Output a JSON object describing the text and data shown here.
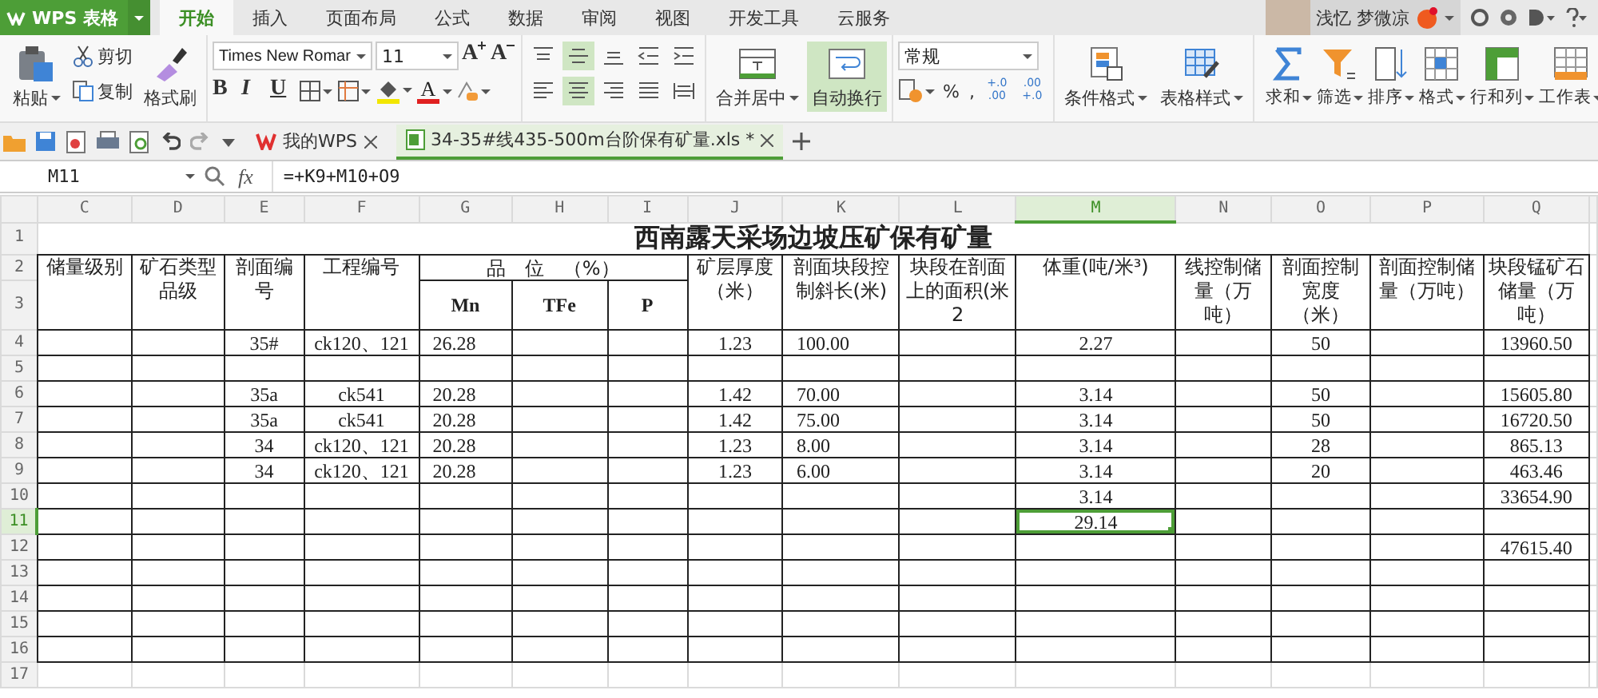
{
  "app": {
    "logo": "WPS 表格"
  },
  "menu_tabs": [
    {
      "label": "开始",
      "selected": true
    },
    {
      "label": "插入",
      "selected": false
    },
    {
      "label": "页面布局",
      "selected": false
    },
    {
      "label": "公式",
      "selected": false
    },
    {
      "label": "数据",
      "selected": false
    },
    {
      "label": "审阅",
      "selected": false
    },
    {
      "label": "视图",
      "selected": false
    },
    {
      "label": "开发工具",
      "selected": false
    },
    {
      "label": "云服务",
      "selected": false
    }
  ],
  "user": {
    "name": "浅忆 梦微凉"
  },
  "ribbon": {
    "paste": "粘贴",
    "cut": "剪切",
    "copy": "复制",
    "format_painter": "格式刷",
    "font": {
      "name": "Times New Romar",
      "size": "11"
    },
    "font_size_buttons": [
      {
        "label": "A",
        "kind": "grow"
      },
      {
        "label": "A",
        "kind": "shrink"
      }
    ],
    "style_buttons": [
      "B",
      "I",
      "U"
    ],
    "font_color": "A",
    "align_buttons": [
      {
        "kind": "top",
        "selected": false
      },
      {
        "kind": "middle",
        "selected": true
      },
      {
        "kind": "bottom",
        "selected": false
      },
      {
        "kind": "outdent",
        "selected": false
      },
      {
        "kind": "indent",
        "selected": false
      },
      {
        "kind": "left",
        "selected": false
      },
      {
        "kind": "center",
        "selected": true
      },
      {
        "kind": "right",
        "selected": false
      },
      {
        "kind": "justify",
        "selected": false
      },
      {
        "kind": "distributed",
        "selected": false
      }
    ],
    "merge": {
      "label": "合并居中"
    },
    "wrap": {
      "label": "自动换行",
      "on": true
    },
    "number_format": "常规",
    "percent": "%",
    "comma": ",",
    "decimal_buttons": [
      {
        "top": "+.0",
        "bottom": ".00"
      },
      {
        "top": ".00",
        "bottom": "+.0"
      }
    ],
    "format_buttons": [
      "条件格式",
      "表格样式"
    ],
    "tools": [
      {
        "label": "求和",
        "kind": "sum"
      },
      {
        "label": "筛选",
        "kind": "filter"
      },
      {
        "label": "排序",
        "kind": "sort"
      },
      {
        "label": "格式",
        "kind": "format"
      },
      {
        "label": "行和列",
        "kind": "rows"
      },
      {
        "label": "工作表",
        "kind": "sheet"
      }
    ]
  },
  "doc_tabs": [
    {
      "label": "我的WPS",
      "kind": "home",
      "selected": false
    },
    {
      "label": "34-35#线435-500m台阶保有矿量.xls *",
      "kind": "sheet",
      "selected": true
    }
  ],
  "formula_bar": {
    "cell": "M11",
    "fx": "fx",
    "formula": "=+K9+M10+O9"
  },
  "sheet": {
    "columns": [
      {
        "letter": "C",
        "selected": false
      },
      {
        "letter": "D",
        "selected": false
      },
      {
        "letter": "E",
        "selected": false
      },
      {
        "letter": "F",
        "selected": false
      },
      {
        "letter": "G",
        "selected": false
      },
      {
        "letter": "H",
        "selected": false
      },
      {
        "letter": "I",
        "selected": false
      },
      {
        "letter": "J",
        "selected": false
      },
      {
        "letter": "K",
        "selected": false
      },
      {
        "letter": "L",
        "selected": false
      },
      {
        "letter": "M",
        "selected": true
      },
      {
        "letter": "N",
        "selected": false
      },
      {
        "letter": "O",
        "selected": false
      },
      {
        "letter": "P",
        "selected": false
      },
      {
        "letter": "Q",
        "selected": false
      }
    ],
    "header_cells": [
      {
        "kind": "tall",
        "text": "储量级别"
      },
      {
        "kind": "tall",
        "text": "矿石类型品级"
      },
      {
        "kind": "tall",
        "text": "剖面编号"
      },
      {
        "kind": "tall",
        "text": "工程编号"
      },
      {
        "kind": "group",
        "text": "品　位　（%）"
      },
      {
        "kind": "sub",
        "text": "Mn"
      },
      {
        "kind": "sub",
        "text": "TFe"
      },
      {
        "kind": "sub",
        "text": "P"
      },
      {
        "kind": "tall",
        "text": "矿层厚度（米）"
      },
      {
        "kind": "tall",
        "text": "剖面块段控制斜长(米)"
      },
      {
        "kind": "tall",
        "text": "块段在剖面上的面积(米2"
      },
      {
        "kind": "tall",
        "text": "体重(吨/米³)"
      },
      {
        "kind": "tall",
        "text": "线控制储量（万吨）"
      },
      {
        "kind": "tall",
        "text": "剖面控制宽度（米）"
      },
      {
        "kind": "tall",
        "text": "剖面控制储量（万吨）"
      },
      {
        "kind": "tall",
        "text": "块段锰矿石储量（万吨）"
      }
    ],
    "rows": [
      {
        "number": "1",
        "kind": "title",
        "selected": false,
        "text": "西南露天采场边坡压矿保有矿量"
      },
      {
        "number": "2",
        "kind": "header",
        "selected": false
      },
      {
        "number": "3",
        "kind": "header",
        "selected": false
      },
      {
        "number": "4",
        "kind": "data",
        "selected": false,
        "cells": {
          "E": {
            "text": "35#",
            "selected": false
          },
          "F": {
            "text": "ck120、121",
            "selected": false
          },
          "G": {
            "text": "26.28",
            "selected": false
          },
          "J": {
            "text": "1.23",
            "selected": false
          },
          "K": {
            "text": "100.00",
            "selected": false
          },
          "M": {
            "text": "2.27",
            "selected": false
          },
          "O": {
            "text": "50",
            "selected": false
          },
          "Q": {
            "text": "13960.50",
            "selected": false
          }
        }
      },
      {
        "number": "5",
        "kind": "data",
        "selected": false
      },
      {
        "number": "6",
        "kind": "data",
        "selected": false,
        "cells": {
          "E": {
            "text": "35a",
            "selected": false
          },
          "F": {
            "text": "ck541",
            "selected": false
          },
          "G": {
            "text": "20.28",
            "selected": false
          },
          "J": {
            "text": "1.42",
            "selected": false
          },
          "K": {
            "text": "70.00",
            "selected": false
          },
          "M": {
            "text": "3.14",
            "selected": false
          },
          "O": {
            "text": "50",
            "selected": false
          },
          "Q": {
            "text": "15605.80",
            "selected": false
          }
        }
      },
      {
        "number": "7",
        "kind": "data",
        "selected": false,
        "cells": {
          "E": {
            "text": "35a",
            "selected": false
          },
          "F": {
            "text": "ck541",
            "selected": false
          },
          "G": {
            "text": "20.28",
            "selected": false
          },
          "J": {
            "text": "1.42",
            "selected": false
          },
          "K": {
            "text": "75.00",
            "selected": false
          },
          "M": {
            "text": "3.14",
            "selected": false
          },
          "O": {
            "text": "50",
            "selected": false
          },
          "Q": {
            "text": "16720.50",
            "selected": false
          }
        }
      },
      {
        "number": "8",
        "kind": "data",
        "selected": false,
        "cells": {
          "E": {
            "text": "34",
            "selected": false
          },
          "F": {
            "text": "ck120、121",
            "selected": false
          },
          "G": {
            "text": "20.28",
            "selected": false
          },
          "J": {
            "text": "1.23",
            "selected": false
          },
          "K": {
            "text": "8.00",
            "selected": false
          },
          "M": {
            "text": "3.14",
            "selected": false
          },
          "O": {
            "text": "28",
            "selected": false
          },
          "Q": {
            "text": "865.13",
            "selected": false
          }
        }
      },
      {
        "number": "9",
        "kind": "data",
        "selected": false,
        "cells": {
          "E": {
            "text": "34",
            "selected": false
          },
          "F": {
            "text": "ck120、121",
            "selected": false
          },
          "G": {
            "text": "20.28",
            "selected": false
          },
          "J": {
            "text": "1.23",
            "selected": false
          },
          "K": {
            "text": "6.00",
            "selected": false
          },
          "M": {
            "text": "3.14",
            "selected": false
          },
          "O": {
            "text": "20",
            "selected": false
          },
          "Q": {
            "text": "463.46",
            "selected": false
          }
        }
      },
      {
        "number": "10",
        "kind": "data",
        "selected": false,
        "cells": {
          "M": {
            "text": "3.14",
            "selected": false
          },
          "Q": {
            "text": "33654.90",
            "selected": false
          }
        }
      },
      {
        "number": "11",
        "kind": "data",
        "selected": true,
        "cells": {
          "M": {
            "text": "29.14",
            "selected": true
          }
        }
      },
      {
        "number": "12",
        "kind": "data",
        "selected": false,
        "cells": {
          "Q": {
            "text": "47615.40",
            "selected": false
          }
        }
      },
      {
        "number": "13",
        "kind": "data",
        "selected": false
      },
      {
        "number": "14",
        "kind": "data",
        "selected": false
      },
      {
        "number": "15",
        "kind": "data",
        "selected": false
      },
      {
        "number": "16",
        "kind": "data",
        "selected": false
      },
      {
        "number": "17",
        "kind": "blank",
        "selected": false
      }
    ]
  }
}
